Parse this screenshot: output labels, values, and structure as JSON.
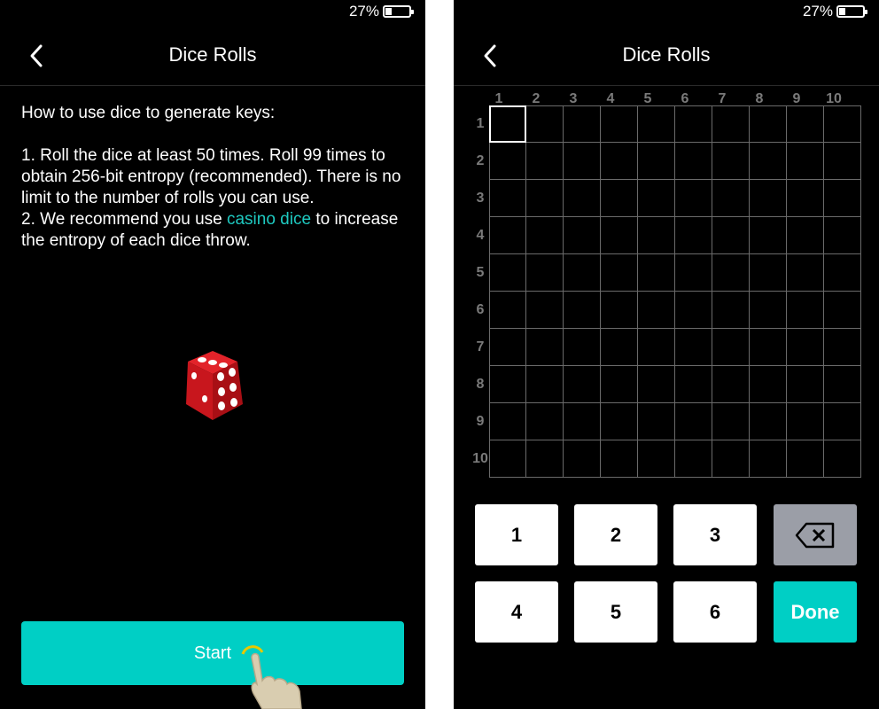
{
  "status": {
    "battery_text": "27%",
    "battery_level": 0.27
  },
  "left": {
    "title": "Dice Rolls",
    "instructions": {
      "heading": "How to use dice to generate keys:",
      "step1": "1. Roll the dice at least 50 times. Roll 99 times to obtain 256-bit entropy (recommended). There is no limit to the number of rolls you can use.",
      "step2_prefix": "2. We recommend you use ",
      "step2_link": "casino dice",
      "step2_suffix": " to increase the entropy of each dice throw."
    },
    "start_label": "Start"
  },
  "right": {
    "title": "Dice Rolls",
    "columns": [
      "1",
      "2",
      "3",
      "4",
      "5",
      "6",
      "7",
      "8",
      "9",
      "10"
    ],
    "rows": [
      "1",
      "2",
      "3",
      "4",
      "5",
      "6",
      "7",
      "8",
      "9",
      "10"
    ],
    "keypad": {
      "k1": "1",
      "k2": "2",
      "k3": "3",
      "k4": "4",
      "k5": "5",
      "k6": "6",
      "done": "Done",
      "backspace_icon": "backspace-icon"
    }
  },
  "colors": {
    "accent": "#00cfc5",
    "link": "#1ec9c0",
    "background": "#000000",
    "backspace_key": "#9b9ea7"
  }
}
